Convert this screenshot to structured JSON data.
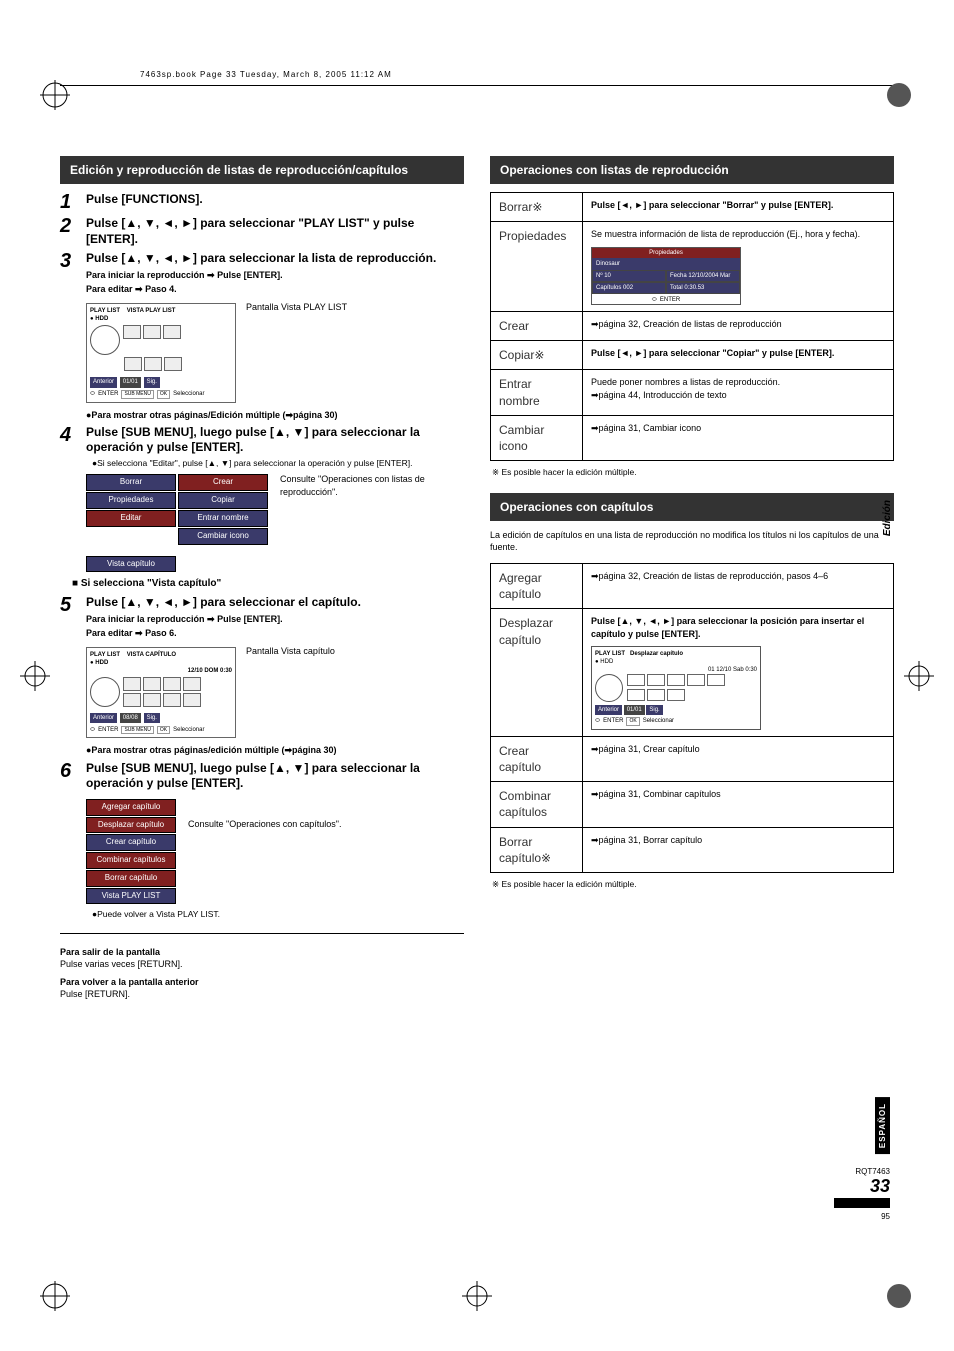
{
  "meta": {
    "bookline": "7463sp.book  Page 33  Tuesday, March 8, 2005  11:12 AM"
  },
  "left": {
    "title": "Edición y reproducción de listas de reproducción/capítulos",
    "steps": {
      "s1": {
        "main": "Pulse [FUNCTIONS]."
      },
      "s2": {
        "main": "Pulse [▲, ▼, ◄, ►] para seleccionar \"PLAY LIST\" y pulse [ENTER]."
      },
      "s3": {
        "main": "Pulse [▲, ▼, ◄, ►] para seleccionar la lista de reproducción.",
        "sub1": "Para iniciar la reproducción ➡ Pulse [ENTER].",
        "sub2": "Para editar ➡ Paso 4.",
        "diag_label": "Pantalla Vista PLAY LIST",
        "diag_t1": "PLAY LIST",
        "diag_t2": "VISTA PLAY LIST",
        "diag_hdd": "● HDD",
        "diag_anterior": "Anterior",
        "diag_sig": "Sig.",
        "diag_submenu": "SUB MENU",
        "diag_sel": "Seleccionar",
        "diag_enter": "ENTER",
        "diag_pg": "01/01",
        "bullet": "●Para mostrar otras páginas/Edición múltiple (➡página 30)"
      },
      "s4": {
        "main": "Pulse [SUB MENU], luego pulse [▲, ▼] para seleccionar la operación y pulse [ENTER].",
        "bullet": "●Si selecciona \"Editar\", pulse [▲, ▼] para seleccionar la operación y pulse [ENTER].",
        "menu_left": [
          "Borrar",
          "Propiedades",
          "Editar"
        ],
        "menu_right": [
          "Crear",
          "Copiar",
          "Entrar nombre",
          "Cambiar icono"
        ],
        "menu_bottom": "Vista capítulo",
        "consult": "Consulte \"Operaciones con listas de reproducción\"."
      },
      "subheading": "■ Si selecciona \"Vista capítulo\"",
      "s5": {
        "main": "Pulse [▲, ▼, ◄, ►] para seleccionar el capítulo.",
        "sub1": "Para iniciar la reproducción ➡ Pulse [ENTER].",
        "sub2": "Para editar ➡ Paso 6.",
        "diag_label": "Pantalla Vista capítulo",
        "diag_t1": "PLAY LIST",
        "diag_t2": "VISTA CAPÍTULO",
        "diag_hdd": "● HDD",
        "diag_date": "12/10 DOM 0:30",
        "diag_anterior": "Anterior",
        "diag_sig": "Sig.",
        "diag_submenu": "SUB MENU",
        "diag_sel": "Seleccionar",
        "diag_enter": "ENTER",
        "diag_pg": "08/08",
        "bullet": "●Para mostrar otras páginas/edición múltiple (➡página 30)"
      },
      "s6": {
        "main": "Pulse [SUB MENU], luego pulse [▲, ▼] para seleccionar la operación y pulse [ENTER].",
        "menu": [
          "Agregar capítulo",
          "Desplazar capítulo",
          "Crear capítulo",
          "Combinar capítulos",
          "Borrar capítulo",
          "Vista PLAY LIST"
        ],
        "consult": "Consulte \"Operaciones con capítulos\".",
        "bullet": "●Puede volver a Vista PLAY LIST."
      }
    },
    "exit": {
      "h1": "Para salir de la pantalla",
      "t1": "Pulse varias veces [RETURN].",
      "h2": "Para volver a la pantalla anterior",
      "t2": "Pulse [RETURN]."
    }
  },
  "right": {
    "title1": "Operaciones con listas de reproducción",
    "rows1": {
      "borrar": {
        "k": "Borrar※",
        "v": "Pulse [◄, ►] para seleccionar \"Borrar\" y pulse [ENTER]."
      },
      "propiedades": {
        "k": "Propiedades",
        "v": "Se muestra información de lista de reproducción (Ej., hora y fecha).",
        "box": {
          "h": "Propiedades",
          "title": "Dinosaur",
          "no_k": "Nº",
          "no_v": "10",
          "date_k": "Fecha",
          "date_v": "12/10/2004 Mar",
          "cap_k": "Capítulos",
          "cap_v": "002",
          "tot_k": "Total",
          "tot_v": "0:30.53"
        }
      },
      "crear": {
        "k": "Crear",
        "v": "➡página 32, Creación de listas de reproducción"
      },
      "copiar": {
        "k": "Copiar※",
        "v": "Pulse [◄, ►] para seleccionar \"Copiar\" y pulse [ENTER]."
      },
      "entrar": {
        "k": "Entrar nombre",
        "v": "Puede poner nombres a listas de reproducción.\n➡página 44, Introducción de texto"
      },
      "cambiar": {
        "k": "Cambiar icono",
        "v": "➡página 31, Cambiar icono"
      }
    },
    "ast1": "※ Es posible hacer la edición múltiple.",
    "title2": "Operaciones con capítulos",
    "chapnote": "La edición de capítulos en una lista de reproducción no modifica los títulos ni los capítulos de una fuente.",
    "rows2": {
      "agregar": {
        "k": "Agregar capítulo",
        "v": "➡página 32, Creación de listas de reproducción, pasos 4–6"
      },
      "desplazar": {
        "k": "Desplazar capítulo",
        "v": "Pulse [▲, ▼, ◄, ►] para seleccionar la posición para insertar el capítulo y pulse [ENTER].",
        "box": {
          "t1": "PLAY LIST",
          "t2": "Desplazar capítulo",
          "hdd": "● HDD",
          "date": "01 12/10 Sab 0:30",
          "anterior": "Anterior",
          "pg": "01/01",
          "sig": "Sig.",
          "enter": "ENTER",
          "sel": "Seleccionar"
        }
      },
      "crearcap": {
        "k": "Crear capítulo",
        "v": "➡página 31, Crear capítulo"
      },
      "combinar": {
        "k": "Combinar capítulos",
        "v": "➡página 31, Combinar capítulos"
      },
      "borrarcap": {
        "k": "Borrar capítulo※",
        "v": "➡página 31, Borrar capítulo"
      }
    },
    "ast2": "※ Es posible hacer la edición múltiple."
  },
  "side": {
    "edicion": "Edición",
    "espanol": "ESPAÑOL"
  },
  "footer": {
    "rqt": "RQT7463",
    "page": "33",
    "sub": "95"
  }
}
